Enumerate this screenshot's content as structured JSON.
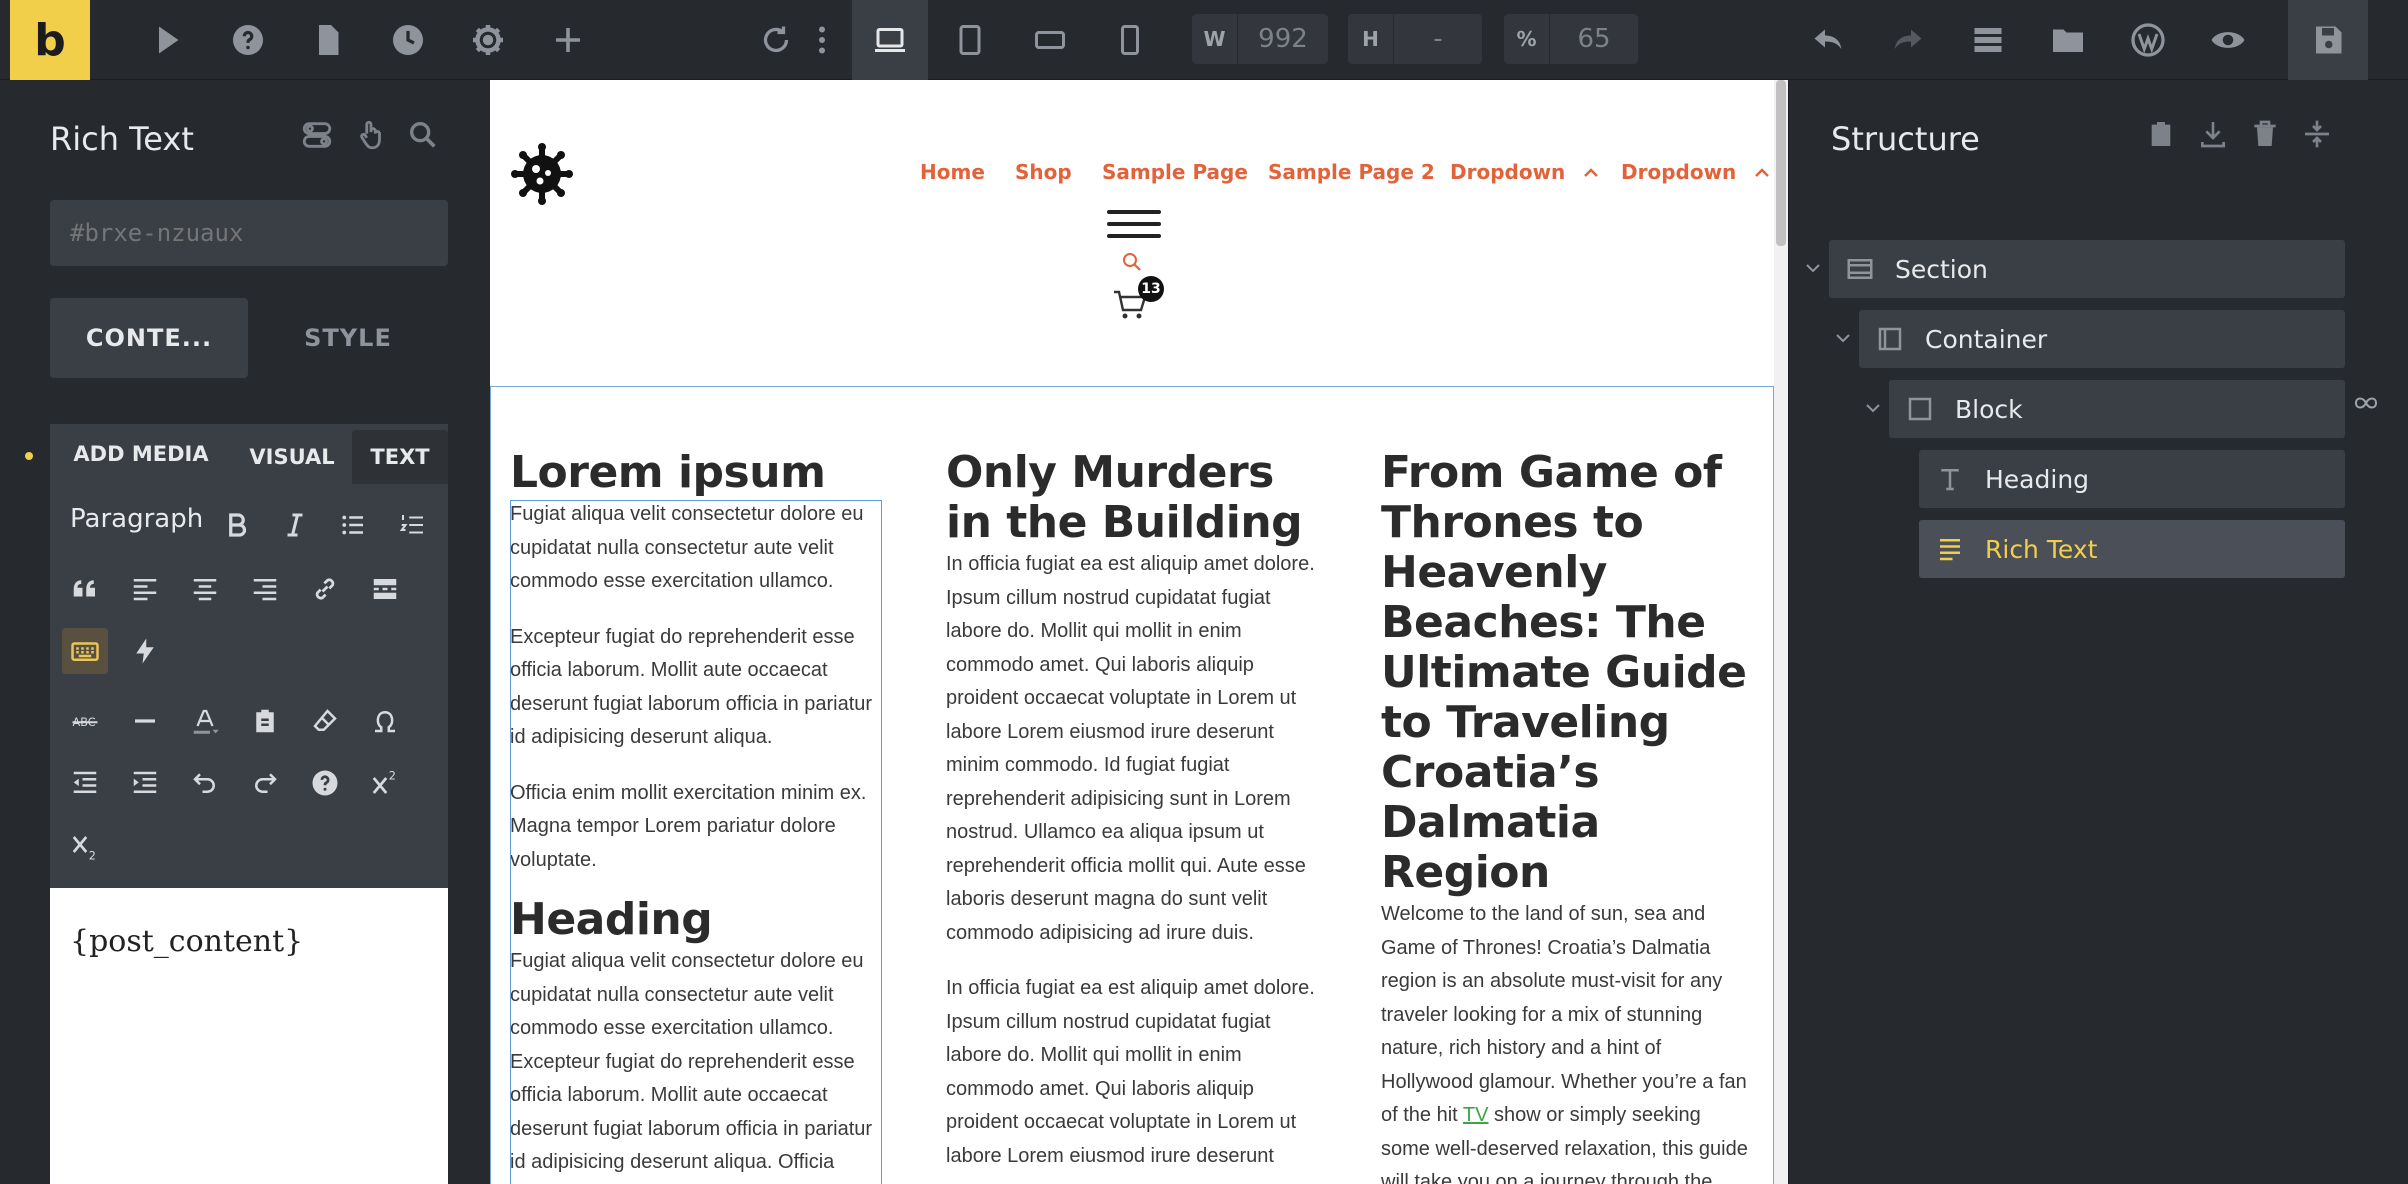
{
  "app": {
    "logo_letter": "b"
  },
  "topbar": {
    "width_label": "W",
    "width_value": "992",
    "height_label": "H",
    "height_value": "-",
    "zoom_label": "%",
    "zoom_value": "65"
  },
  "left_panel": {
    "title": "Rich Text",
    "css_id_placeholder": "#brxe-nzuaux",
    "tab_content": "CONTE...",
    "tab_style": "STYLE",
    "editor": {
      "add_media": "ADD MEDIA",
      "visual_tab": "VISUAL",
      "text_tab": "TEXT",
      "paragraph_select": "Paragraph",
      "content": "{post_content}"
    }
  },
  "canvas": {
    "nav": [
      {
        "label": "Home"
      },
      {
        "label": "Shop"
      },
      {
        "label": "Sample Page"
      },
      {
        "label": "Sample Page 2"
      },
      {
        "label": "Dropdown"
      },
      {
        "label": "Dropdown"
      }
    ],
    "cart_count": "13",
    "col1": {
      "heading": "Lorem ipsum",
      "p1": "Fugiat aliqua velit consectetur dolore eu cupidatat nulla consectetur aute velit commodo esse exercitation ullamco.",
      "p2": "Excepteur fugiat do reprehenderit esse officia laborum. Mollit aute occaecat deserunt fugiat laborum officia in pariatur id adipisicing deserunt aliqua.",
      "p3": "Officia enim mollit exercitation minim ex. Magna tempor Lorem pariatur dolore voluptate.",
      "heading2": "Heading",
      "p4": "Fugiat aliqua velit consectetur dolore eu cupidatat nulla consectetur aute velit commodo esse exercitation ullamco. Excepteur fugiat do reprehenderit esse officia laborum. Mollit aute occaecat deserunt fugiat laborum officia in pariatur id adipisicing deserunt aliqua. Officia"
    },
    "col2": {
      "heading": "Only Murders in the Building",
      "p1": "In officia fugiat ea est aliquip amet dolore. Ipsum cillum nostrud cupidatat fugiat labore do. Mollit qui mollit in enim commodo amet. Qui laboris aliquip proident occaecat voluptate in Lorem ut labore Lorem eiusmod irure deserunt minim commodo. Id fugiat fugiat reprehenderit adipisicing sunt in Lorem nostrud. Ullamco ea aliqua ipsum ut reprehenderit officia mollit qui. Aute esse laboris deserunt magna do sunt velit commodo adipisicing ad irure duis.",
      "p2": "In officia fugiat ea est aliquip amet dolore. Ipsum cillum nostrud cupidatat fugiat labore do. Mollit qui mollit in enim commodo amet. Qui laboris aliquip proident occaecat voluptate in Lorem ut labore Lorem eiusmod irure deserunt"
    },
    "col3": {
      "heading": "From Game of Thrones to Heavenly Beaches: The Ultimate Guide to Traveling Croatia’s Dalmatia Region",
      "p_before_link": "Welcome to the land of sun, sea and Game of Thrones! Croatia’s Dalmatia region is an absolute must-visit for any traveler looking for a mix of stunning nature, rich history and a hint of Hollywood glamour. Whether you’re a fan of the hit ",
      "link": "TV",
      "p_after_link": " show or simply seeking some well-deserved relaxation, this guide will take you on a journey through the best beaches, charming towns and"
    }
  },
  "right_panel": {
    "title": "Structure",
    "tree": [
      {
        "label": "Section"
      },
      {
        "label": "Container"
      },
      {
        "label": "Block"
      },
      {
        "label": "Heading"
      },
      {
        "label": "Rich Text"
      }
    ]
  },
  "colors": {
    "accent": "#f2cf4a",
    "nav_link": "#e2623a",
    "content_link": "#3ca54a",
    "panel_bg": "#26292e"
  }
}
